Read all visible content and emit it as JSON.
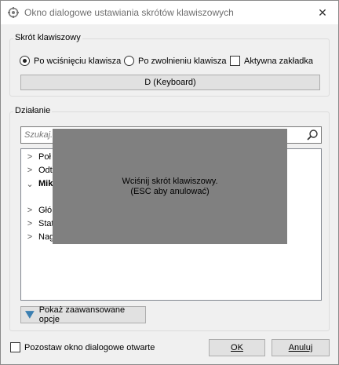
{
  "window": {
    "title": "Okno dialogowe ustawiania skrótów klawiszowych",
    "close_glyph": "✕"
  },
  "shortcut_group": {
    "label": "Skrót klawiszowy",
    "radio_on_press": "Po wciśnięciu klawisza",
    "radio_on_release": "Po zwolnieniu klawisza",
    "active_tab_checkbox": "Aktywna zakładka",
    "selected_option": "Po wciśnięciu klawisza",
    "key_button": "D (Keyboard)"
  },
  "action_group": {
    "label": "Działanie",
    "search_placeholder": "Szukaj...",
    "tree_items": [
      {
        "label": "Poł",
        "expanded": false,
        "bold": false
      },
      {
        "label": "Odt",
        "expanded": false,
        "bold": false
      },
      {
        "label": "Mik",
        "expanded": true,
        "bold": true
      },
      {
        "label": "Głó",
        "expanded": false,
        "bold": false
      },
      {
        "label": "Stat",
        "expanded": false,
        "bold": false
      },
      {
        "label": "Nag",
        "expanded": false,
        "bold": false
      }
    ],
    "overlay_line1": "Wciśnij skrót klawiszowy.",
    "overlay_line2": "(ESC aby anulować)",
    "advanced_button": "Pokaż zaawansowane opcje"
  },
  "footer": {
    "keep_open_checkbox": "Pozostaw okno dialogowe otwarte",
    "ok_button": "OK",
    "cancel_button": "Anuluj"
  },
  "icons": {
    "app": "keyboard-settings-icon",
    "search": "search-icon",
    "advanced": "triangle-down-icon",
    "tree_collapsed": "chevron-right-icon",
    "tree_expanded": "chevron-down-icon"
  },
  "colors": {
    "window_bg": "#f0f0f0",
    "overlay": "#808080",
    "accent_icon": "#3c7fb1"
  }
}
